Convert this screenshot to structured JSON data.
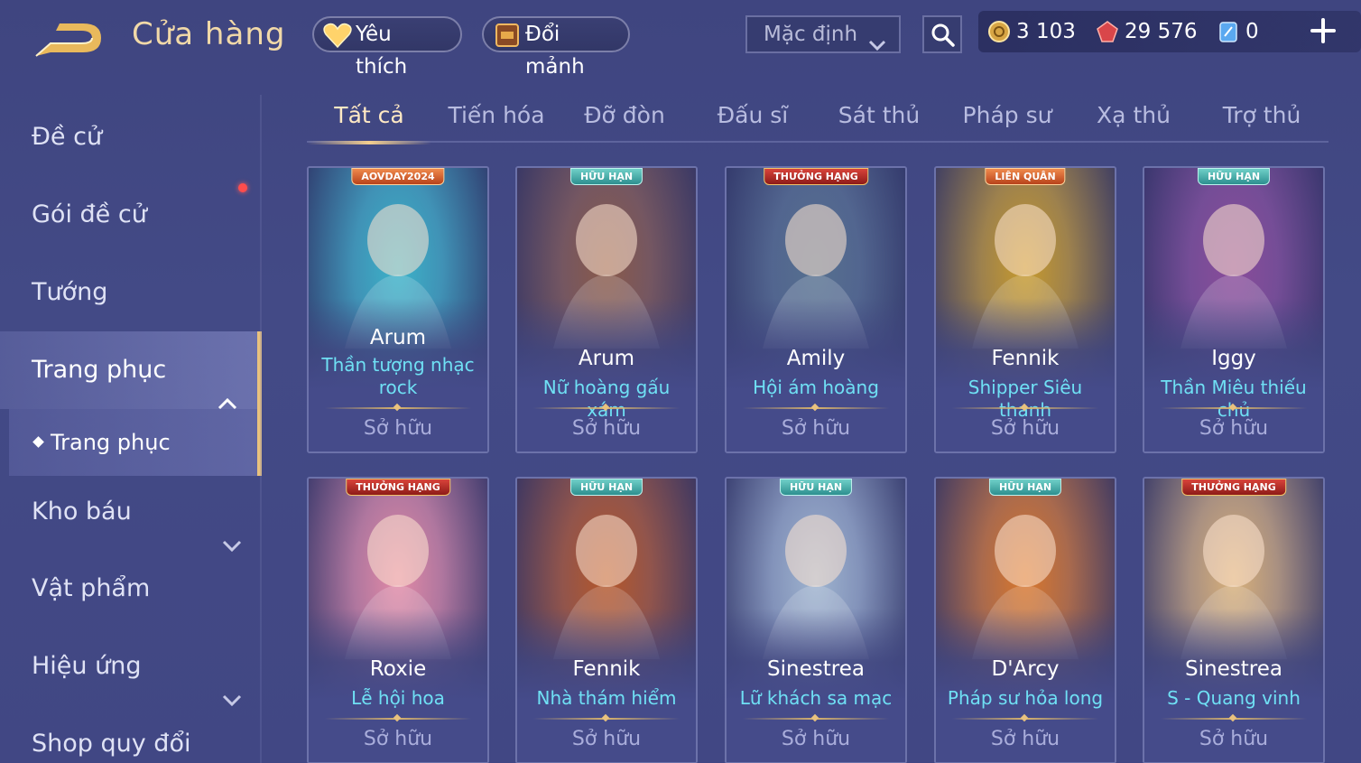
{
  "header": {
    "title": "Cửa hàng",
    "favorite_label": "Yêu thích",
    "exchange_label": "Đổi mảnh",
    "sort_value": "Mặc định",
    "currencies": {
      "gold": "3 103",
      "ruby": "29 576",
      "voucher": "0"
    }
  },
  "sidebar": {
    "items": [
      {
        "label": "Đề cử"
      },
      {
        "label": "Gói đề cử"
      },
      {
        "label": "Tướng"
      },
      {
        "label": "Trang phục"
      },
      {
        "label": "Kho báu"
      },
      {
        "label": "Vật phẩm"
      },
      {
        "label": "Hiệu ứng"
      },
      {
        "label": "Shop quy đổi"
      }
    ],
    "sub_item": "Trang phục"
  },
  "tabs": [
    {
      "label": "Tất cả"
    },
    {
      "label": "Tiến hóa"
    },
    {
      "label": "Đỡ đòn"
    },
    {
      "label": "Đấu sĩ"
    },
    {
      "label": "Sát thủ"
    },
    {
      "label": "Pháp sư"
    },
    {
      "label": "Xạ thủ"
    },
    {
      "label": "Trợ thủ"
    }
  ],
  "skins": [
    {
      "hero": "Arum",
      "skin": "Thần tượng nhạc rock",
      "status": "Sở hữu",
      "badge": "AOVDAY2024",
      "color": "#3bb3c9"
    },
    {
      "hero": "Arum",
      "skin": "Nữ hoàng gấu xám",
      "status": "Sở hữu",
      "badge": "HỮU HẠN",
      "color": "#8a5a4a"
    },
    {
      "hero": "Amily",
      "skin": "Hội ám hoàng",
      "status": "Sở hữu",
      "badge": "THƯỞNG HẠNG",
      "color": "#56708f"
    },
    {
      "hero": "Fennik",
      "skin": "Shipper Siêu thanh",
      "status": "Sở hữu",
      "badge": "LIÊN QUÂN",
      "color": "#c79a2c"
    },
    {
      "hero": "Iggy",
      "skin": "Thần Miêu thiếu chủ",
      "status": "Sở hữu",
      "badge": "HỮU HẠN",
      "color": "#8a4c9a"
    },
    {
      "hero": "Roxie",
      "skin": "Lễ hội hoa",
      "status": "Sở hữu",
      "badge": "THƯỞNG HẠNG",
      "color": "#e28aa6"
    },
    {
      "hero": "Fennik",
      "skin": "Nhà thám hiểm",
      "status": "Sở hữu",
      "badge": "HỮU HẠN",
      "color": "#b5572a"
    },
    {
      "hero": "Sinestrea",
      "skin": "Lữ khách sa mạc",
      "status": "Sở hữu",
      "badge": "HỮU HẠN",
      "color": "#9fb4cf"
    },
    {
      "hero": "D'Arcy",
      "skin": "Pháp sư hỏa long",
      "status": "Sở hữu",
      "badge": "HỮU HẠN",
      "color": "#d9772c"
    },
    {
      "hero": "Sinestrea",
      "skin": "S - Quang vinh",
      "status": "Sở hữu",
      "badge": "THƯỞNG HẠNG",
      "color": "#d8b07a"
    }
  ]
}
